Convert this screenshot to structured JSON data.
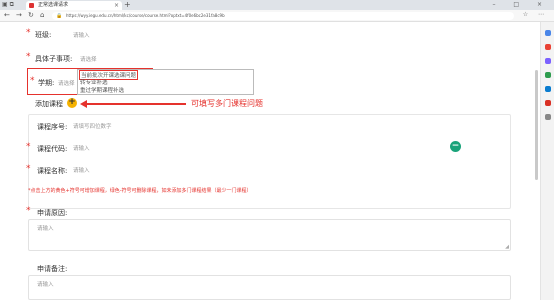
{
  "browser": {
    "tab_title": "正常选课请求",
    "url": "https://wyy.iegu.edu.cn/html/kc/course/course.html?optxt=4f0e6bc2e31fa8c9b"
  },
  "form": {
    "class_label": "班级:",
    "class_placeholder": "请输入",
    "subject_label": "具体子事项:",
    "subject_placeholder": "请选择",
    "term_label": "学期:",
    "term_placeholder": "请选择",
    "term_options": [
      "当前批次开课选课问题",
      "转专业补选",
      "重过学期课程补选"
    ],
    "add_course_label": "添加课程",
    "add_button": "+",
    "annotation": "可填写多门课程问题",
    "course_no_label": "课程序号:",
    "course_no_placeholder": "请填写四位数字",
    "course_code_label": "课程代码:",
    "course_code_placeholder": "请输入",
    "course_name_label": "课程名称:",
    "course_name_placeholder": "请输入",
    "remove_button": "−",
    "hint": "*点击上方的黄色+符号可增加课程，绿色-符号可删除课程，如未添加多门课程结果（最少一门课程）",
    "reason_label": "申请原因:",
    "reason_placeholder": "请输入",
    "remark_label": "申请备注:",
    "remark_placeholder": "请输入",
    "required_mark": "*"
  },
  "colors": {
    "required": "#e5322d",
    "add_button": "#f5b200",
    "remove_button": "#1aa37a"
  }
}
